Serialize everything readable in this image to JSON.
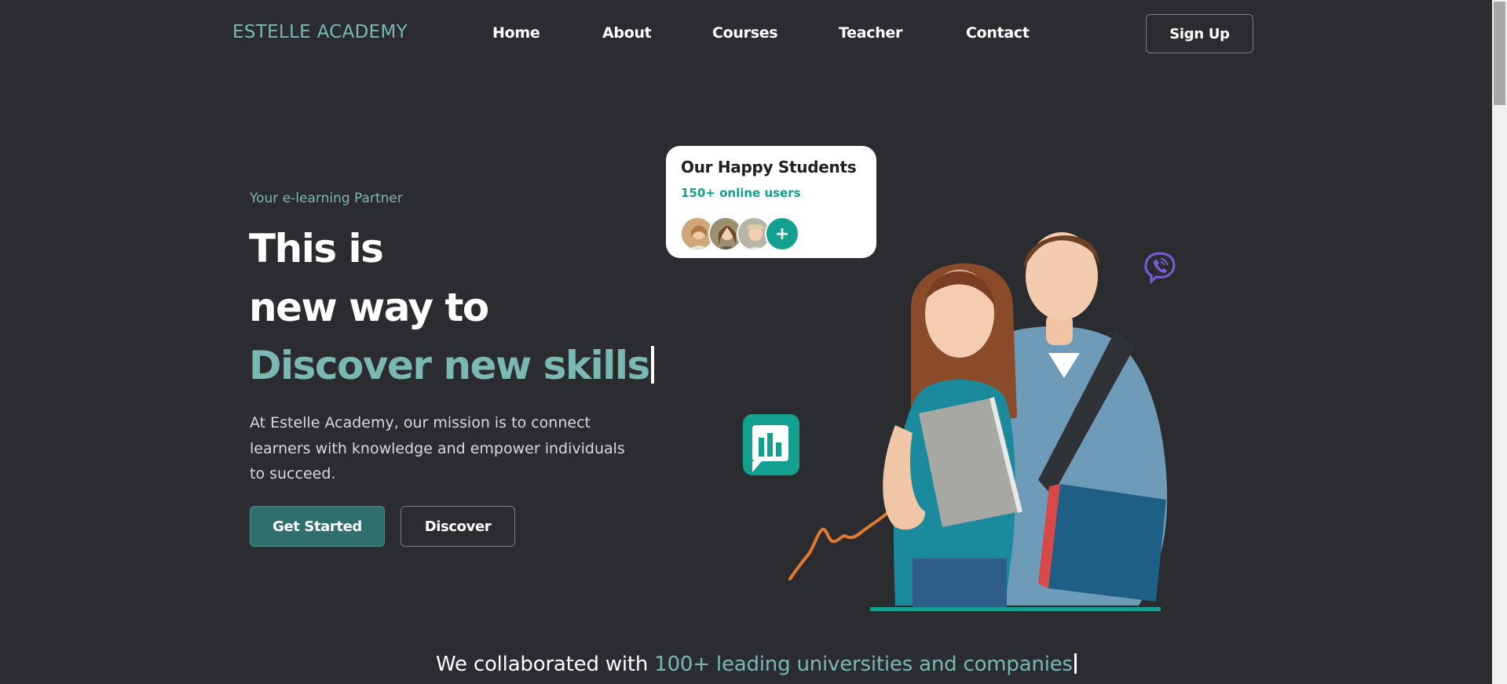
{
  "header": {
    "logo": "ESTELLE ACADEMY",
    "nav": [
      "Home",
      "About",
      "Courses",
      "Teacher",
      "Contact"
    ],
    "signup_label": "Sign Up"
  },
  "hero": {
    "tagline": "Your e-learning Partner",
    "line1": "This is",
    "line2": "new way to",
    "line3": "Discover new skills",
    "description": "At Estelle Academy, our mission is to connect learners with knowledge and empower individuals to succeed.",
    "primary_button": "Get Started",
    "secondary_button": "Discover"
  },
  "students_card": {
    "title": "Our Happy Students",
    "subtitle": "150+ online users",
    "plus": "+"
  },
  "collab": {
    "prefix": "We collaborated with ",
    "highlight": "100+ leading universities and companies"
  },
  "colors": {
    "background": "#2b2c30",
    "accent": "#7bb8b2",
    "teal": "#14a08e",
    "primary_button": "#2f6f6d",
    "squiggle": "#e07a2e",
    "viber": "#7b5cd6"
  },
  "icons": [
    "chart-icon",
    "viber-icon",
    "squiggle-line-icon"
  ]
}
